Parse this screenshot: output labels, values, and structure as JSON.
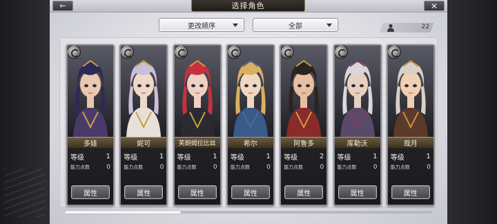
{
  "header": {
    "title": "选择角色",
    "back_icon": "arrow-left-icon",
    "close_icon": "close-icon"
  },
  "toolbar": {
    "sort_label": "更改顺序",
    "filter_label": "全部",
    "character_count": "22",
    "count_icon": "person-icon"
  },
  "cards": [
    {
      "name": "多娃",
      "level_label": "等级",
      "level": "1",
      "ability_label": "能力点数",
      "ability_points": "0",
      "attr_button": "属性",
      "hair": "#2e2a55",
      "skin": "#e8c8b0",
      "cloth": "#4a3a6a",
      "accent": "#c8a050"
    },
    {
      "name": "妮可",
      "level_label": "等级",
      "level": "1",
      "ability_label": "能力点数",
      "ability_points": "0",
      "attr_button": "属性",
      "hair": "#c8c0d8",
      "skin": "#f0d8c8",
      "cloth": "#e8e0d8",
      "accent": "#c8a040"
    },
    {
      "name": "芙朗姆拉比丝",
      "level_label": "等级",
      "level": "1",
      "ability_label": "能力点数",
      "ability_points": "0",
      "attr_button": "属性",
      "hair": "#c83040",
      "skin": "#f0d0c0",
      "cloth": "#2a2a30",
      "accent": "#c8a040"
    },
    {
      "name": "希尔",
      "level_label": "等级",
      "level": "1",
      "ability_label": "能力点数",
      "ability_points": "0",
      "attr_button": "属性",
      "hair": "#d8b060",
      "skin": "#f0d8c0",
      "cloth": "#3a5a8a",
      "accent": "#4a6a9a"
    },
    {
      "name": "阿鲁多",
      "level_label": "等级",
      "level": "2",
      "ability_label": "能力点数",
      "ability_points": "0",
      "attr_button": "属性",
      "hair": "#2a2420",
      "skin": "#e8c0a0",
      "cloth": "#8a2a2a",
      "accent": "#c8a040"
    },
    {
      "name": "库勒沃",
      "level_label": "等级",
      "level": "1",
      "ability_label": "能力点数",
      "ability_points": "0",
      "attr_button": "属性",
      "hair": "#d8d8dc",
      "skin": "#e8d0c0",
      "cloth": "#5a4a6a",
      "accent": "#8a3a5a"
    },
    {
      "name": "哉月",
      "level_label": "等级",
      "level": "1",
      "ability_label": "能力点数",
      "ability_points": "0",
      "attr_button": "属性",
      "hair": "#d8d0c8",
      "skin": "#f0d0b0",
      "cloth": "#5a3a2a",
      "accent": "#c89040"
    }
  ],
  "scrollbar": {
    "position": 0
  }
}
